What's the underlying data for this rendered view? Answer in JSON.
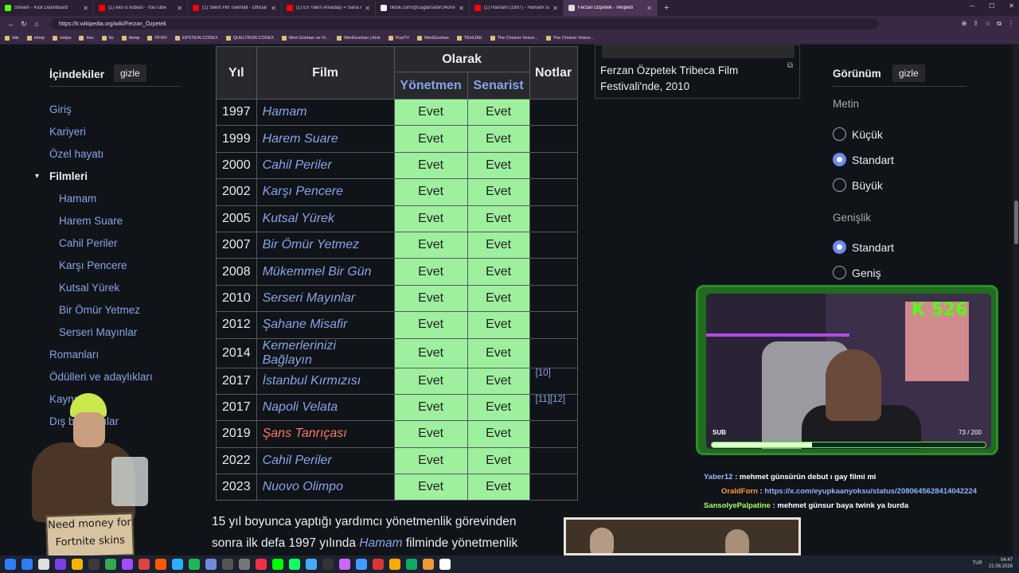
{
  "browser": {
    "tabs": [
      {
        "title": "Stream - Kick Dashboard",
        "color": "#53fc18",
        "active": false
      },
      {
        "title": "(1) eko is kobian - YouTube",
        "color": "#ff0000",
        "active": false
      },
      {
        "title": "(1) Silent Hill Townfall - Official G...",
        "color": "#ff0000",
        "active": false
      },
      {
        "title": "(1) En Yakın Arkadaşı = Sana Açıkç...",
        "color": "#ff0000",
        "active": false
      },
      {
        "title": "tiktok.com/@caglarsahin343/vid...",
        "color": "#ffffff",
        "active": false
      },
      {
        "title": "(1) Hamam (1997) - Hamam sahn...",
        "color": "#ff0000",
        "active": false
      },
      {
        "title": "Ferzan Özpetek - Vikipedi",
        "color": "#dddddd",
        "active": true
      }
    ],
    "url": "https://tr.wikipedia.org/wiki/Ferzan_Özpetek",
    "bookmarks": [
      "/dis",
      "/shop",
      "/vidya",
      "/mu",
      "/to",
      "/temp",
      "FFXIV",
      "EPSTEIN CODEX",
      "QUELTRON CODEX",
      "Mert Günhan ve Vi...",
      "MertGunhan | Kick",
      "FluxTV",
      "MertGunhan",
      "TEHLİKE",
      "The Choicer Voicer...",
      "The Choicer Voicer..."
    ]
  },
  "toc": {
    "title": "İçindekiler",
    "hide_label": "gizle",
    "items": [
      {
        "label": "Giriş",
        "level": 1
      },
      {
        "label": "Kariyeri",
        "level": 1
      },
      {
        "label": "Özel hayatı",
        "level": 1
      },
      {
        "label": "Filmleri",
        "level": 1,
        "bold": true
      },
      {
        "label": "Hamam",
        "level": 2
      },
      {
        "label": "Harem Suare",
        "level": 2
      },
      {
        "label": "Cahil Periler",
        "level": 2
      },
      {
        "label": "Karşı Pencere",
        "level": 2
      },
      {
        "label": "Kutsal Yürek",
        "level": 2
      },
      {
        "label": "Bir Ömür Yetmez",
        "level": 2
      },
      {
        "label": "Serseri Mayınlar",
        "level": 2
      },
      {
        "label": "Romanları",
        "level": 1
      },
      {
        "label": "Ödülleri ve adaylıkları",
        "level": 1
      },
      {
        "label": "Kaynakça",
        "level": 1
      },
      {
        "label": "Dış bağlantılar",
        "level": 1
      }
    ]
  },
  "table": {
    "headers": {
      "year": "Yıl",
      "film": "Film",
      "as": "Olarak",
      "director": "Yönetmen",
      "writer": "Senarist",
      "notes": "Notlar"
    },
    "rows": [
      {
        "year": "1997",
        "film": "Hamam",
        "director": "Evet",
        "writer": "Evet",
        "notes": ""
      },
      {
        "year": "1999",
        "film": "Harem Suare",
        "director": "Evet",
        "writer": "Evet",
        "notes": ""
      },
      {
        "year": "2000",
        "film": "Cahil Periler",
        "director": "Evet",
        "writer": "Evet",
        "notes": ""
      },
      {
        "year": "2002",
        "film": "Karşı Pencere",
        "director": "Evet",
        "writer": "Evet",
        "notes": ""
      },
      {
        "year": "2005",
        "film": "Kutsal Yürek",
        "director": "Evet",
        "writer": "Evet",
        "notes": ""
      },
      {
        "year": "2007",
        "film": "Bir Ömür Yetmez",
        "director": "Evet",
        "writer": "Evet",
        "notes": ""
      },
      {
        "year": "2008",
        "film": "Mükemmel Bir Gün",
        "director": "Evet",
        "writer": "Evet",
        "notes": ""
      },
      {
        "year": "2010",
        "film": "Serseri Mayınlar",
        "director": "Evet",
        "writer": "Evet",
        "notes": ""
      },
      {
        "year": "2012",
        "film": "Şahane Misafir",
        "director": "Evet",
        "writer": "Evet",
        "notes": ""
      },
      {
        "year": "2014",
        "film": "Kemerlerinizi Bağlayın",
        "director": "Evet",
        "writer": "Evet",
        "notes": ""
      },
      {
        "year": "2017",
        "film": "İstanbul Kırmızısı",
        "director": "Evet",
        "writer": "Evet",
        "notes": "[10]"
      },
      {
        "year": "2017",
        "film": "Napoli Velata",
        "director": "Evet",
        "writer": "Evet",
        "notes": "[11][12]"
      },
      {
        "year": "2019",
        "film": "Şans Tanrıçası",
        "director": "Evet",
        "writer": "Evet",
        "notes": "",
        "redlink": true
      },
      {
        "year": "2022",
        "film": "Cahil Periler",
        "director": "Evet",
        "writer": "Evet",
        "notes": ""
      },
      {
        "year": "2023",
        "film": "Nuovo Olimpo",
        "director": "Evet",
        "writer": "Evet",
        "notes": ""
      }
    ]
  },
  "image_caption": "Ferzan Özpetek Tribeca Film Festivali'nde, 2010",
  "paragraph": {
    "before": "15 yıl boyunca yaptığı yardımcı yönetmenlik görevinden sonra ilk defa 1997 yılında ",
    "link": "Hamam",
    "after": " filminde yönetmenlik"
  },
  "appearance": {
    "title": "Görünüm",
    "hide_label": "gizle",
    "text_section": "Metin",
    "text_options": [
      {
        "label": "Küçük",
        "selected": false
      },
      {
        "label": "Standart",
        "selected": true
      },
      {
        "label": "Büyük",
        "selected": false
      }
    ],
    "width_section": "Genişlik",
    "width_options": [
      {
        "label": "Standart",
        "selected": true
      },
      {
        "label": "Geniş",
        "selected": false
      }
    ]
  },
  "stream": {
    "kick_counter": "K 526",
    "sub_label": "SUB",
    "sub_count": "73 / 200",
    "sub_progress": 0.365,
    "chat": [
      {
        "user": "Yaber12",
        "message": " : mehmet günsürün debut ı gay filmi mi"
      },
      {
        "user": "OraldForn",
        "message": " : ",
        "link": "https://x.com/eyupkaanyoksu/status/2080645628414042224"
      },
      {
        "user": "SansolyePalpatine",
        "message": " : mehmet günsur baya twink ya burda"
      }
    ],
    "sign_lines": [
      "Need money for",
      "Fortnite skins"
    ]
  },
  "taskbar": {
    "lang": "TUR",
    "time": "04:47",
    "date": "21.08.2026"
  }
}
